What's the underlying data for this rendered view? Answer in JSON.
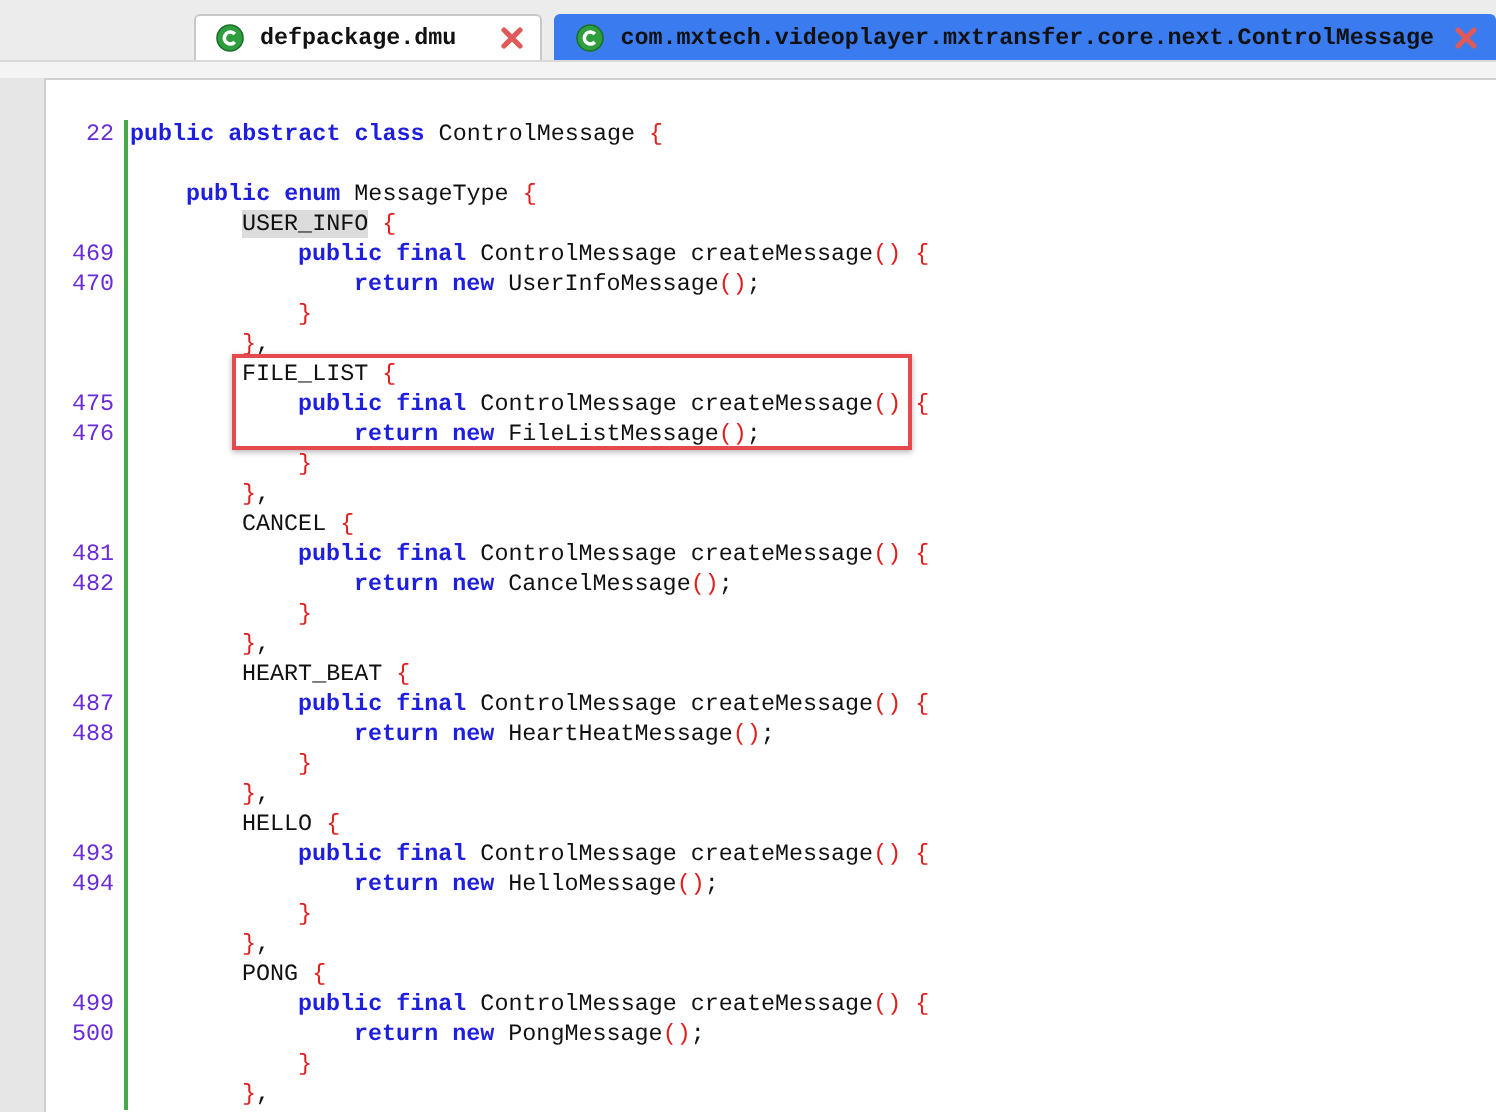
{
  "tabs": [
    {
      "label": "defpackage.dmu",
      "selected": false
    },
    {
      "label": "com.mxtech.videoplayer.mxtransfer.core.next.ControlMessage",
      "selected": true
    }
  ],
  "lines": [
    {
      "number": "22",
      "boxed": false,
      "segments": [
        {
          "kind": "keyword",
          "text": "public abstract class"
        },
        {
          "kind": "text",
          "text": " ControlMessage"
        },
        {
          "kind": "brace",
          "text": " {"
        }
      ],
      "children": [
        {
          "gap_before": true,
          "boxed": false,
          "segments": [
            {
              "kind": "keyword",
              "text": "public enum"
            },
            {
              "kind": "text",
              "text": " MessageType"
            },
            {
              "kind": "brace",
              "text": " {"
            }
          ],
          "children": [
            {
              "boxed": false,
              "segments": [
                {
                  "kind": "marked",
                  "text": "USER_INFO"
                },
                {
                  "kind": "brace",
                  "text": " {"
                }
              ],
              "children": [
                {
                  "number": "469",
                  "boxed": false,
                  "segments": [
                    {
                      "kind": "keyword",
                      "text": "public final"
                    },
                    {
                      "kind": "text",
                      "text": " ControlMessage createMessage"
                    },
                    {
                      "kind": "brace",
                      "text": "() {"
                    }
                  ],
                  "children": [
                    {
                      "number": "470",
                      "boxed": false,
                      "segments": [
                        {
                          "kind": "keyword",
                          "text": "return new"
                        },
                        {
                          "kind": "text",
                          "text": " UserInfoMessage"
                        },
                        {
                          "kind": "brace",
                          "text": "()"
                        },
                        {
                          "kind": "text",
                          "text": ";"
                        }
                      ]
                    }
                  ]
                },
                {
                  "boxed": false,
                  "segments": [
                    {
                      "kind": "brace",
                      "text": "}"
                    }
                  ]
                }
              ]
            },
            {
              "boxed": false,
              "segments": [
                {
                  "kind": "brace",
                  "text": "}"
                },
                {
                  "kind": "text",
                  "text": ","
                }
              ]
            },
            {
              "boxed": true,
              "segments": [
                {
                  "kind": "text",
                  "text": "FILE_LIST"
                },
                {
                  "kind": "brace",
                  "text": " {"
                }
              ],
              "children": [
                {
                  "number": "475",
                  "boxed": true,
                  "segments": [
                    {
                      "kind": "keyword",
                      "text": "public final"
                    },
                    {
                      "kind": "text",
                      "text": " ControlMessage createMessage"
                    },
                    {
                      "kind": "brace",
                      "text": "() {"
                    }
                  ],
                  "children": [
                    {
                      "number": "476",
                      "boxed": true,
                      "segments": [
                        {
                          "kind": "keyword",
                          "text": "return new"
                        },
                        {
                          "kind": "text",
                          "text": " FileListMessage"
                        },
                        {
                          "kind": "brace",
                          "text": "()"
                        },
                        {
                          "kind": "text",
                          "text": ";"
                        }
                      ]
                    }
                  ]
                },
                {
                  "boxed": false,
                  "segments": [
                    {
                      "kind": "brace",
                      "text": "}"
                    }
                  ]
                }
              ]
            },
            {
              "boxed": false,
              "segments": [
                {
                  "kind": "brace",
                  "text": "}"
                },
                {
                  "kind": "text",
                  "text": ","
                }
              ]
            },
            {
              "boxed": false,
              "segments": [
                {
                  "kind": "text",
                  "text": "CANCEL"
                },
                {
                  "kind": "brace",
                  "text": " {"
                }
              ],
              "children": [
                {
                  "number": "481",
                  "boxed": false,
                  "segments": [
                    {
                      "kind": "keyword",
                      "text": "public final"
                    },
                    {
                      "kind": "text",
                      "text": " ControlMessage createMessage"
                    },
                    {
                      "kind": "brace",
                      "text": "() {"
                    }
                  ],
                  "children": [
                    {
                      "number": "482",
                      "boxed": false,
                      "segments": [
                        {
                          "kind": "keyword",
                          "text": "return new"
                        },
                        {
                          "kind": "text",
                          "text": " CancelMessage"
                        },
                        {
                          "kind": "brace",
                          "text": "()"
                        },
                        {
                          "kind": "text",
                          "text": ";"
                        }
                      ]
                    }
                  ]
                },
                {
                  "boxed": false,
                  "segments": [
                    {
                      "kind": "brace",
                      "text": "}"
                    }
                  ]
                }
              ]
            },
            {
              "boxed": false,
              "segments": [
                {
                  "kind": "brace",
                  "text": "}"
                },
                {
                  "kind": "text",
                  "text": ","
                }
              ]
            },
            {
              "boxed": false,
              "segments": [
                {
                  "kind": "text",
                  "text": "HEART_BEAT"
                },
                {
                  "kind": "brace",
                  "text": " {"
                }
              ],
              "children": [
                {
                  "number": "487",
                  "boxed": false,
                  "segments": [
                    {
                      "kind": "keyword",
                      "text": "public final"
                    },
                    {
                      "kind": "text",
                      "text": " ControlMessage createMessage"
                    },
                    {
                      "kind": "brace",
                      "text": "() {"
                    }
                  ],
                  "children": [
                    {
                      "number": "488",
                      "boxed": false,
                      "segments": [
                        {
                          "kind": "keyword",
                          "text": "return new"
                        },
                        {
                          "kind": "text",
                          "text": " HeartHeatMessage"
                        },
                        {
                          "kind": "brace",
                          "text": "()"
                        },
                        {
                          "kind": "text",
                          "text": ";"
                        }
                      ]
                    }
                  ]
                },
                {
                  "boxed": false,
                  "segments": [
                    {
                      "kind": "brace",
                      "text": "}"
                    }
                  ]
                }
              ]
            },
            {
              "boxed": false,
              "segments": [
                {
                  "kind": "brace",
                  "text": "}"
                },
                {
                  "kind": "text",
                  "text": ","
                }
              ]
            },
            {
              "boxed": false,
              "segments": [
                {
                  "kind": "text",
                  "text": "HELLO"
                },
                {
                  "kind": "brace",
                  "text": " {"
                }
              ],
              "children": [
                {
                  "number": "493",
                  "boxed": false,
                  "segments": [
                    {
                      "kind": "keyword",
                      "text": "public final"
                    },
                    {
                      "kind": "text",
                      "text": " ControlMessage createMessage"
                    },
                    {
                      "kind": "brace",
                      "text": "() {"
                    }
                  ],
                  "children": [
                    {
                      "number": "494",
                      "boxed": false,
                      "segments": [
                        {
                          "kind": "keyword",
                          "text": "return new"
                        },
                        {
                          "kind": "text",
                          "text": " HelloMessage"
                        },
                        {
                          "kind": "brace",
                          "text": "()"
                        },
                        {
                          "kind": "text",
                          "text": ";"
                        }
                      ]
                    }
                  ]
                },
                {
                  "boxed": false,
                  "segments": [
                    {
                      "kind": "brace",
                      "text": "}"
                    }
                  ]
                }
              ]
            },
            {
              "boxed": false,
              "segments": [
                {
                  "kind": "brace",
                  "text": "}"
                },
                {
                  "kind": "text",
                  "text": ","
                }
              ]
            },
            {
              "boxed": false,
              "segments": [
                {
                  "kind": "text",
                  "text": "PONG"
                },
                {
                  "kind": "brace",
                  "text": " {"
                }
              ],
              "children": [
                {
                  "number": "499",
                  "boxed": false,
                  "segments": [
                    {
                      "kind": "keyword",
                      "text": "public final"
                    },
                    {
                      "kind": "text",
                      "text": " ControlMessage createMessage"
                    },
                    {
                      "kind": "brace",
                      "text": "() {"
                    }
                  ],
                  "children": [
                    {
                      "number": "500",
                      "boxed": false,
                      "segments": [
                        {
                          "kind": "keyword",
                          "text": "return new"
                        },
                        {
                          "kind": "text",
                          "text": " PongMessage"
                        },
                        {
                          "kind": "brace",
                          "text": "()"
                        },
                        {
                          "kind": "text",
                          "text": ";"
                        }
                      ]
                    }
                  ]
                },
                {
                  "boxed": false,
                  "segments": [
                    {
                      "kind": "brace",
                      "text": "}"
                    }
                  ]
                }
              ]
            },
            {
              "boxed": false,
              "segments": [
                {
                  "kind": "brace",
                  "text": "}"
                },
                {
                  "kind": "text",
                  "text": ","
                }
              ]
            }
          ]
        }
      ]
    }
  ]
}
